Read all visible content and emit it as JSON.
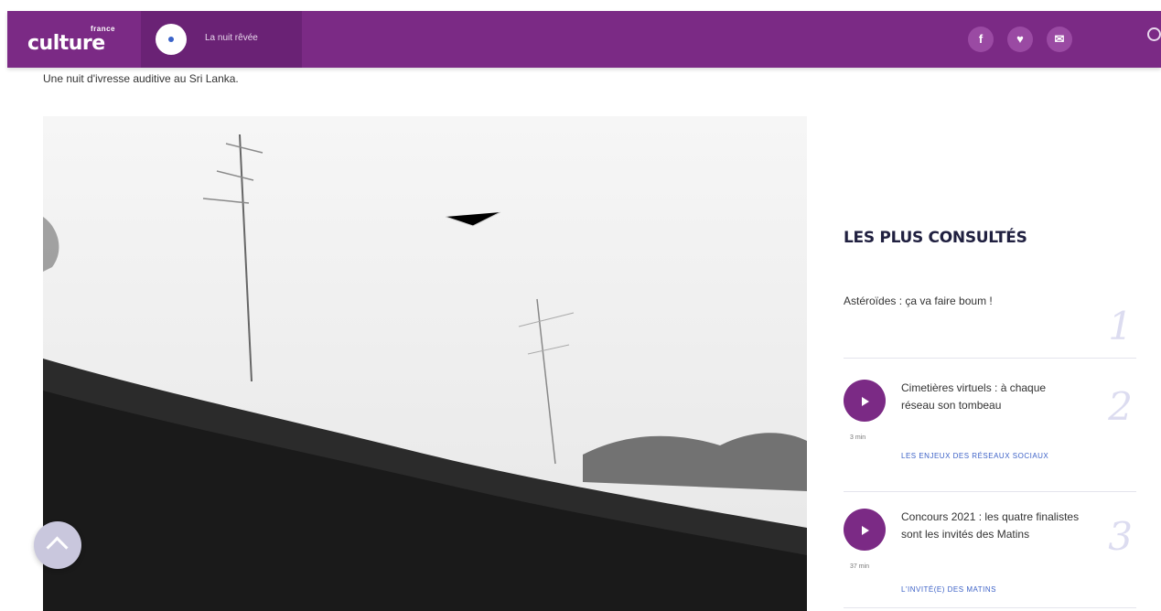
{
  "header": {
    "brand_small": "france",
    "brand_main": "culture",
    "player_label": "La nuit rêvée",
    "social": [
      {
        "icon": "facebook-icon",
        "glyph": "f"
      },
      {
        "icon": "twitter-icon",
        "glyph": "♥"
      },
      {
        "icon": "mail-icon",
        "glyph": "✉"
      }
    ],
    "accent_color": "#7b2a85"
  },
  "article": {
    "subtitle": "Une nuit d'ivresse auditive au Sri Lanka."
  },
  "sidebar": {
    "title": "LES PLUS CONSULTÉS",
    "items": [
      {
        "rank": "1",
        "title": "Astéroïdes : ça va faire boum !"
      },
      {
        "rank": "2",
        "title": "Cimetières virtuels : à chaque réseau son tombeau",
        "duration": "3 min",
        "tag": "LES ENJEUX DES RÉSEAUX SOCIAUX"
      },
      {
        "rank": "3",
        "title": "Concours 2021 : les quatre finalistes sont les invités des Matins",
        "duration": "37 min",
        "tag": "L'INVITÉ(E) DES MATINS"
      }
    ]
  }
}
